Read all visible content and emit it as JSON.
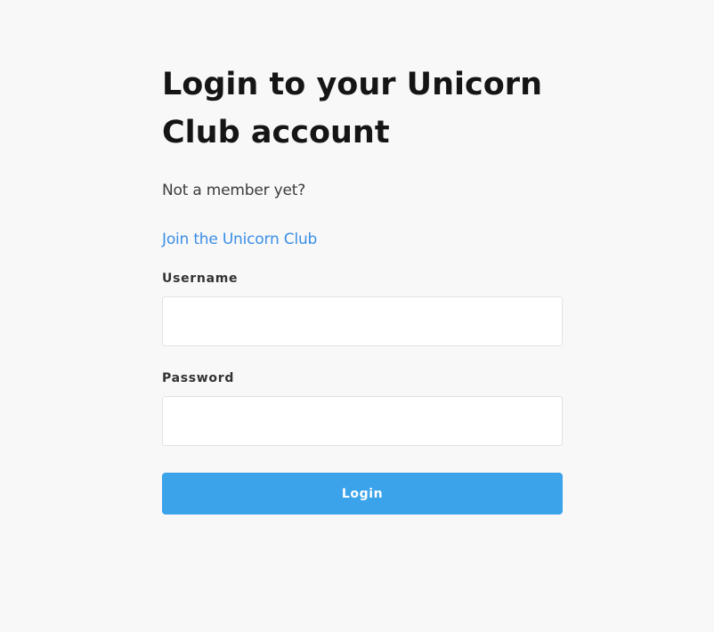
{
  "login": {
    "title": "Login to your Unicorn Club account",
    "subtitle": "Not a member yet?",
    "join_link": "Join the Unicorn Club",
    "username_label": "Username",
    "username_value": "",
    "password_label": "Password",
    "password_value": "",
    "submit_label": "Login"
  },
  "colors": {
    "background": "#f8f8f8",
    "link": "#3a8ee6",
    "button": "#3aa3ea",
    "button_text": "#ffffff",
    "input_border": "#e2e2e2"
  }
}
